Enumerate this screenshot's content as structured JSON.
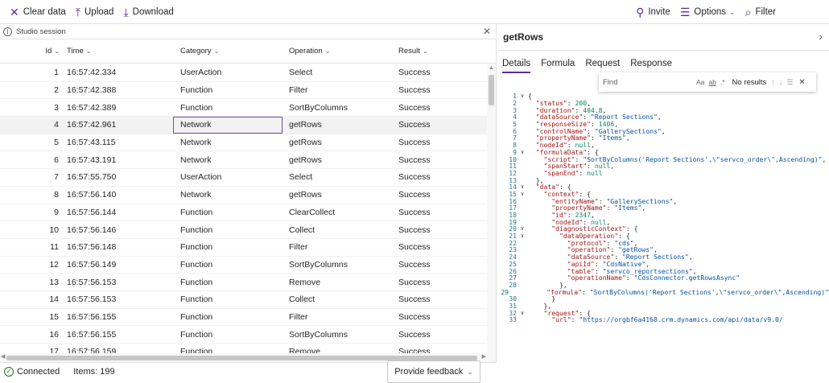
{
  "toolbar": {
    "clear": "Clear data",
    "upload": "Upload",
    "download": "Download",
    "invite": "Invite",
    "options": "Options",
    "filter": "Filter"
  },
  "session": {
    "label": "Studio session"
  },
  "columns": {
    "id": "Id",
    "time": "Time",
    "category": "Category",
    "operation": "Operation",
    "result": "Result"
  },
  "rows": [
    {
      "id": "1",
      "time": "16:57:42.334",
      "category": "UserAction",
      "operation": "Select",
      "result": "Success"
    },
    {
      "id": "2",
      "time": "16:57:42.388",
      "category": "Function",
      "operation": "Filter",
      "result": "Success"
    },
    {
      "id": "3",
      "time": "16:57:42.389",
      "category": "Function",
      "operation": "SortByColumns",
      "result": "Success"
    },
    {
      "id": "4",
      "time": "16:57:42.961",
      "category": "Network",
      "operation": "getRows",
      "result": "Success"
    },
    {
      "id": "5",
      "time": "16:57:43.115",
      "category": "Network",
      "operation": "getRows",
      "result": "Success"
    },
    {
      "id": "6",
      "time": "16:57:43.191",
      "category": "Network",
      "operation": "getRows",
      "result": "Success"
    },
    {
      "id": "7",
      "time": "16:57:55.750",
      "category": "UserAction",
      "operation": "Select",
      "result": "Success"
    },
    {
      "id": "8",
      "time": "16:57:56.140",
      "category": "Network",
      "operation": "getRows",
      "result": "Success"
    },
    {
      "id": "9",
      "time": "16:57:56.144",
      "category": "Function",
      "operation": "ClearCollect",
      "result": "Success"
    },
    {
      "id": "10",
      "time": "16:57:56.146",
      "category": "Function",
      "operation": "Collect",
      "result": "Success"
    },
    {
      "id": "11",
      "time": "16:57:56.148",
      "category": "Function",
      "operation": "Filter",
      "result": "Success"
    },
    {
      "id": "12",
      "time": "16:57:56.149",
      "category": "Function",
      "operation": "SortByColumns",
      "result": "Success"
    },
    {
      "id": "13",
      "time": "16:57:56.153",
      "category": "Function",
      "operation": "Remove",
      "result": "Success"
    },
    {
      "id": "14",
      "time": "16:57:56.153",
      "category": "Function",
      "operation": "Collect",
      "result": "Success"
    },
    {
      "id": "15",
      "time": "16:57:56.155",
      "category": "Function",
      "operation": "Filter",
      "result": "Success"
    },
    {
      "id": "16",
      "time": "16:57:56.155",
      "category": "Function",
      "operation": "SortByColumns",
      "result": "Success"
    },
    {
      "id": "17",
      "time": "16:57:56.159",
      "category": "Function",
      "operation": "Remove",
      "result": "Success"
    }
  ],
  "selected_row": 3,
  "status": {
    "connected": "Connected",
    "items": "Items: 199",
    "feedback": "Provide feedback"
  },
  "detail": {
    "title": "getRows",
    "tabs": [
      "Details",
      "Formula",
      "Request",
      "Response"
    ],
    "active_tab": "Details",
    "find": {
      "placeholder": "Find",
      "aa": "Aa",
      "word": "ab",
      "regex": ".*",
      "results": "No results"
    },
    "code_lines": [
      "{",
      "  \"status\": 200,",
      "  \"duration\": 404.8,",
      "  \"dataSource\": \"Report Sections\",",
      "  \"responseSize\": 1406,",
      "  \"controlName\": \"GallerySections\",",
      "  \"propertyName\": \"Items\",",
      "  \"nodeId\": null,",
      "  \"formulaData\": {",
      "    \"script\": \"SortByColumns('Report Sections',\\\"servco_order\\\",Ascending)\",",
      "    \"spanStart\": null,",
      "    \"spanEnd\": null",
      "  },",
      "  \"data\": {",
      "    \"context\": {",
      "      \"entityName\": \"GallerySections\",",
      "      \"propertyName\": \"Items\",",
      "      \"id\": 2347,",
      "      \"nodeId\": null,",
      "      \"diagnosticContext\": {",
      "        \"dataOperation\": {",
      "          \"protocol\": \"cds\",",
      "          \"operation\": \"getRows\",",
      "          \"dataSource\": \"Report Sections\",",
      "          \"apiId\": \"CdsNative\",",
      "          \"table\": \"servco_reportsections\",",
      "          \"operationName\": \"CdsConnector.getRowsAsync\"",
      "        },",
      "        \"formula\": \"SortByColumns('Report Sections',\\\"servco_order\\\",Ascending)\"",
      "      }",
      "    },",
      "    \"request\": {",
      "      \"url\": \"https://orgbf6a4168.crm.dynamics.com/api/data/v9.0/"
    ],
    "fold_lines": [
      1,
      9,
      14,
      15,
      20,
      21,
      32
    ]
  }
}
